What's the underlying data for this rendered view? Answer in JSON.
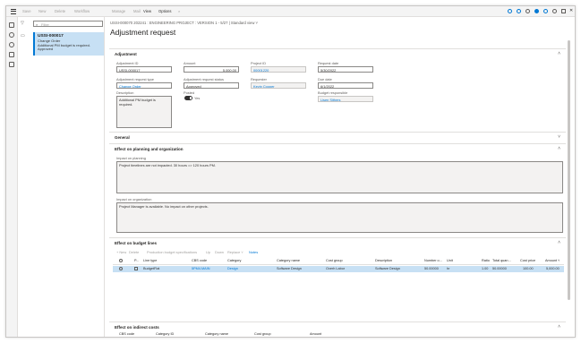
{
  "ribbon": {
    "items": [
      "Save",
      "New",
      "Delete",
      "Workflow",
      "Manage",
      "Mail",
      "View",
      "Options"
    ]
  },
  "list": {
    "filter_placeholder": "Filter",
    "card": {
      "id": "USSI-000017",
      "type": "Change Order",
      "desc": "Additional PM budget is required.",
      "status": "Approved"
    }
  },
  "breadcrumb": "USSI-000070 202241 : ENGINEERING PROJECT : VERSION 1 - 5/27  |  Standard view ˅",
  "page_title": "Adjustment request",
  "sections": {
    "adjustment": "Adjustment",
    "general": "General",
    "effect_planning": "Effect on planning and organization",
    "effect_budget": "Effect on budget lines",
    "effect_indirect": "Effect on indirect costs"
  },
  "adjustment": {
    "adjustment_id_label": "Adjustment ID",
    "adjustment_id": "USSI-000017",
    "type_label": "Adjustment request type",
    "type": "Change Order",
    "description_label": "Description",
    "description": "Additional PM budget is required.",
    "amount_label": "Amount",
    "amount": "5,000.00",
    "status_label": "Adjustment request status",
    "status": "Approved",
    "posted_label": "Posted",
    "posted": "Yes",
    "project_id_label": "Project ID",
    "project_id": "00001220",
    "requester_label": "Requester",
    "requester": "Kevin Cooper",
    "request_date_label": "Request date",
    "request_date": "5/30/2022",
    "due_date_label": "Due date",
    "due_date": "6/1/2022",
    "budget_resp_label": "Budget responsible",
    "budget_resp": "Lisen Sithers"
  },
  "planning": {
    "impact_label": "Impact on planning",
    "impact": "Project timelines are not impacted. 30 hours => 120 hours PM.",
    "org_label": "Impact on organization",
    "org": "Project Manager is available. No impact on other projects."
  },
  "budget_grid": {
    "toolbar": [
      "+ New",
      "Delete",
      "Production budget specifications",
      "Up",
      "Down",
      "Replace ˅",
      "Notes"
    ],
    "headers": [
      "P...",
      "Line type",
      "CBS code",
      "Category",
      "Category name",
      "Cost group",
      "Description",
      "Number o...",
      "Unit",
      "Ratio",
      "Total quan...",
      "Cost price",
      "Amount ˅"
    ],
    "row": [
      "BudgetFlat",
      "5PM4.MAIN",
      "Design",
      "Software Design",
      "Overh Labor",
      "Software Design",
      "50.00000",
      "hr",
      "1.00",
      "50.00000",
      "100.00",
      "5,000.00"
    ]
  },
  "indirect_grid": {
    "headers": [
      "CBS code",
      "Category ID",
      "Category name",
      "Cost group",
      "Amount"
    ]
  },
  "colors": {
    "accent": "#0078d4",
    "selected_row": "#c7e0f4"
  }
}
